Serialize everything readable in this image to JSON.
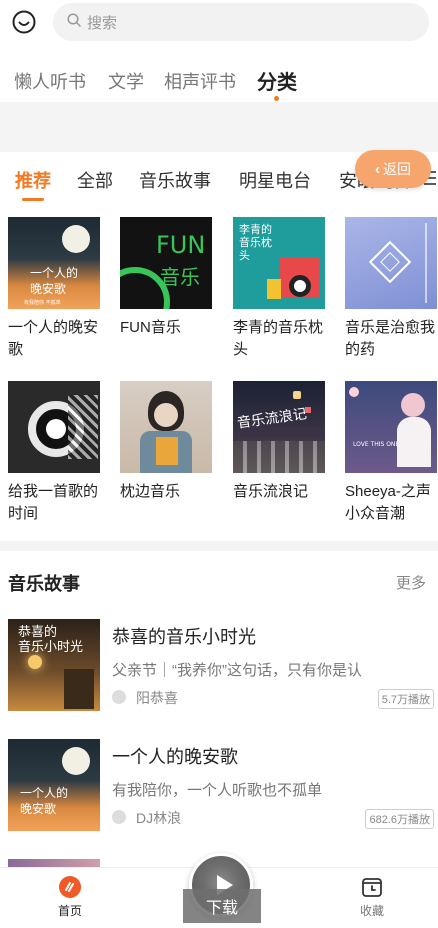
{
  "search": {
    "placeholder": "搜索"
  },
  "channels": [
    "懒人听书",
    "文学",
    "相声评书",
    "分类"
  ],
  "categories": [
    "推荐",
    "全部",
    "音乐故事",
    "明星电台",
    "安眠纯音"
  ],
  "back_button": "返回",
  "albums": [
    {
      "title": "一个人的晚安歌",
      "cover_text": "一个人的\n晚安歌",
      "cover_sub": "有我陪你 不孤单"
    },
    {
      "title": "FUN音乐",
      "cover_text": "FUN",
      "cover_sub": "音乐"
    },
    {
      "title": "李青的音乐枕头",
      "cover_text": "李青的音乐枕头"
    },
    {
      "title": "音乐是治愈我的药",
      "cover_text": ""
    },
    {
      "title": "给我一首歌的时间"
    },
    {
      "title": "枕边音乐"
    },
    {
      "title": "音乐流浪记",
      "cover_text": "音乐流浪记"
    },
    {
      "title": "Sheeya-之声小众音潮",
      "cover_text": "LOVE THIS ONE"
    }
  ],
  "section": {
    "title": "音乐故事",
    "more": "更多"
  },
  "stories": [
    {
      "title": "恭喜的音乐小时光",
      "desc": "父亲节｜“我养你”这句话，只有你是认",
      "author": "阳恭喜",
      "plays": "5.7万播放",
      "thumb_text": "恭喜的\n音乐小时光"
    },
    {
      "title": "一个人的晚安歌",
      "desc": "有我陪你，一个人听歌也不孤单",
      "author": "DJ林浪",
      "plays": "682.6万播放",
      "thumb_text": "一个人的\n晚安歌"
    }
  ],
  "bottom_nav": {
    "home": "首页",
    "download": "下载",
    "favorites": "收藏"
  },
  "colors": {
    "accent": "#f27a25",
    "back_button": "#f6a56c"
  }
}
